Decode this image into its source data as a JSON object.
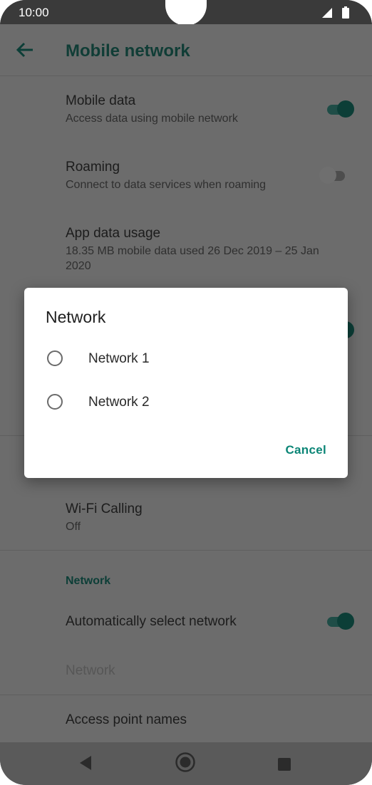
{
  "status_bar": {
    "time": "10:00"
  },
  "app_bar": {
    "title": "Mobile network",
    "back_icon": "arrow-back-icon"
  },
  "settings": {
    "mobile_data": {
      "title": "Mobile data",
      "subtitle": "Access data using mobile network",
      "enabled": true
    },
    "roaming": {
      "title": "Roaming",
      "subtitle": "Connect to data services when roaming",
      "enabled": false
    },
    "app_data_usage": {
      "title": "App data usage",
      "subtitle_line1": "18.35 MB mobile data used 26 Dec 2019 – 25 Jan",
      "subtitle_line2": "2020"
    },
    "wifi_calling": {
      "title": "Wi-Fi Calling",
      "subtitle": "Off"
    },
    "network_section": {
      "header": "Network"
    },
    "auto_select": {
      "title": "Automatically select network",
      "enabled": true
    },
    "network_disabled": {
      "title": "Network"
    },
    "apn": {
      "title": "Access point names"
    }
  },
  "dialog": {
    "title": "Network",
    "options": [
      {
        "label": "Network 1",
        "selected": false
      },
      {
        "label": "Network 2",
        "selected": false
      }
    ],
    "cancel_label": "Cancel"
  },
  "colors": {
    "accent": "#0b8576",
    "scrim_bg": "#6c6c6c"
  }
}
